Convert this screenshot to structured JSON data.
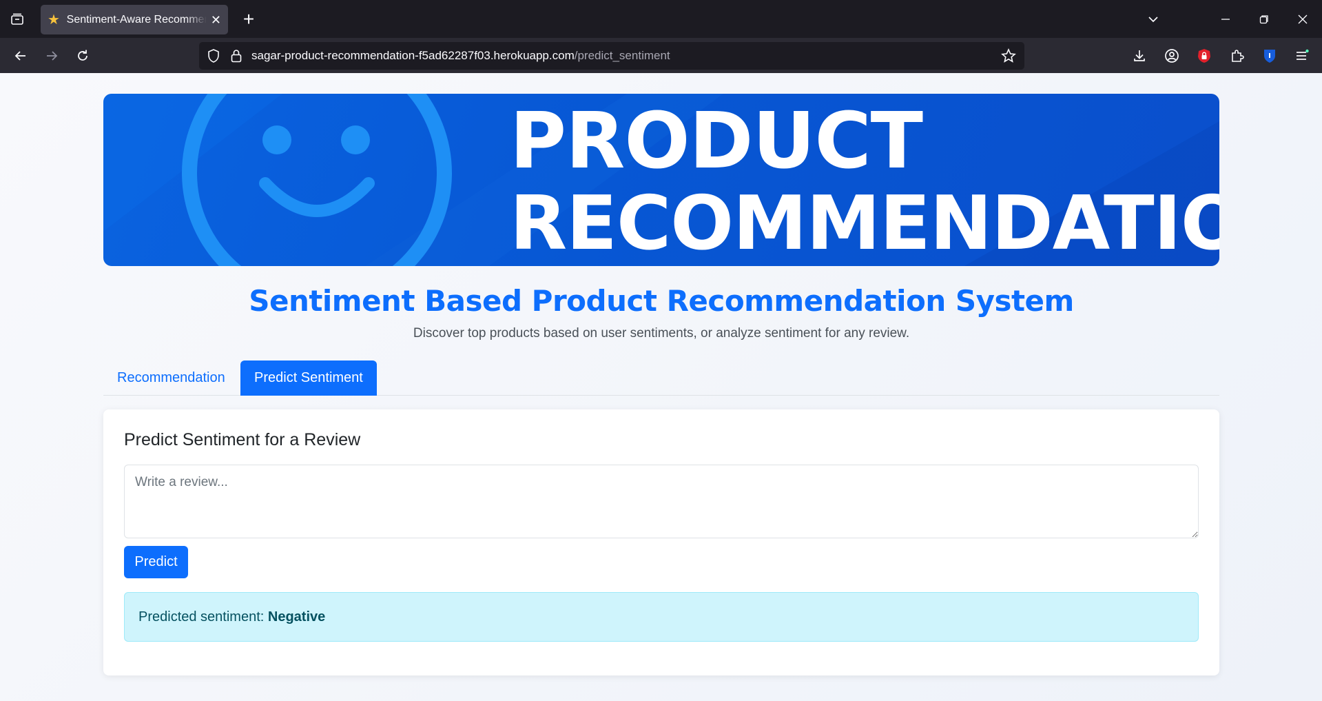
{
  "browser": {
    "tab_title": "Sentiment-Aware Recommender",
    "tab_favicon": "star-icon",
    "url_host": "sagar-product-recommendation-f5ad62287f03.herokuapp.com",
    "url_path": "/predict_sentiment"
  },
  "banner": {
    "line1": "PRODUCT",
    "line2": "RECOMMENDATION",
    "icon": "smiley-face-icon"
  },
  "page": {
    "title": "Sentiment Based Product Recommendation System",
    "subtitle": "Discover top products based on user sentiments, or analyze sentiment for any review."
  },
  "tabs": [
    {
      "label": "Recommendation",
      "active": false
    },
    {
      "label": "Predict Sentiment",
      "active": true
    }
  ],
  "predict_card": {
    "title": "Predict Sentiment for a Review",
    "review_placeholder": "Write a review...",
    "review_value": "",
    "button_label": "Predict",
    "result_label": "Predicted sentiment:",
    "result_value": "Negative"
  },
  "colors": {
    "primary": "#0d6efd",
    "banner_blue": "#0757d4",
    "alert_bg": "#cff4fc",
    "alert_text": "#055160"
  }
}
